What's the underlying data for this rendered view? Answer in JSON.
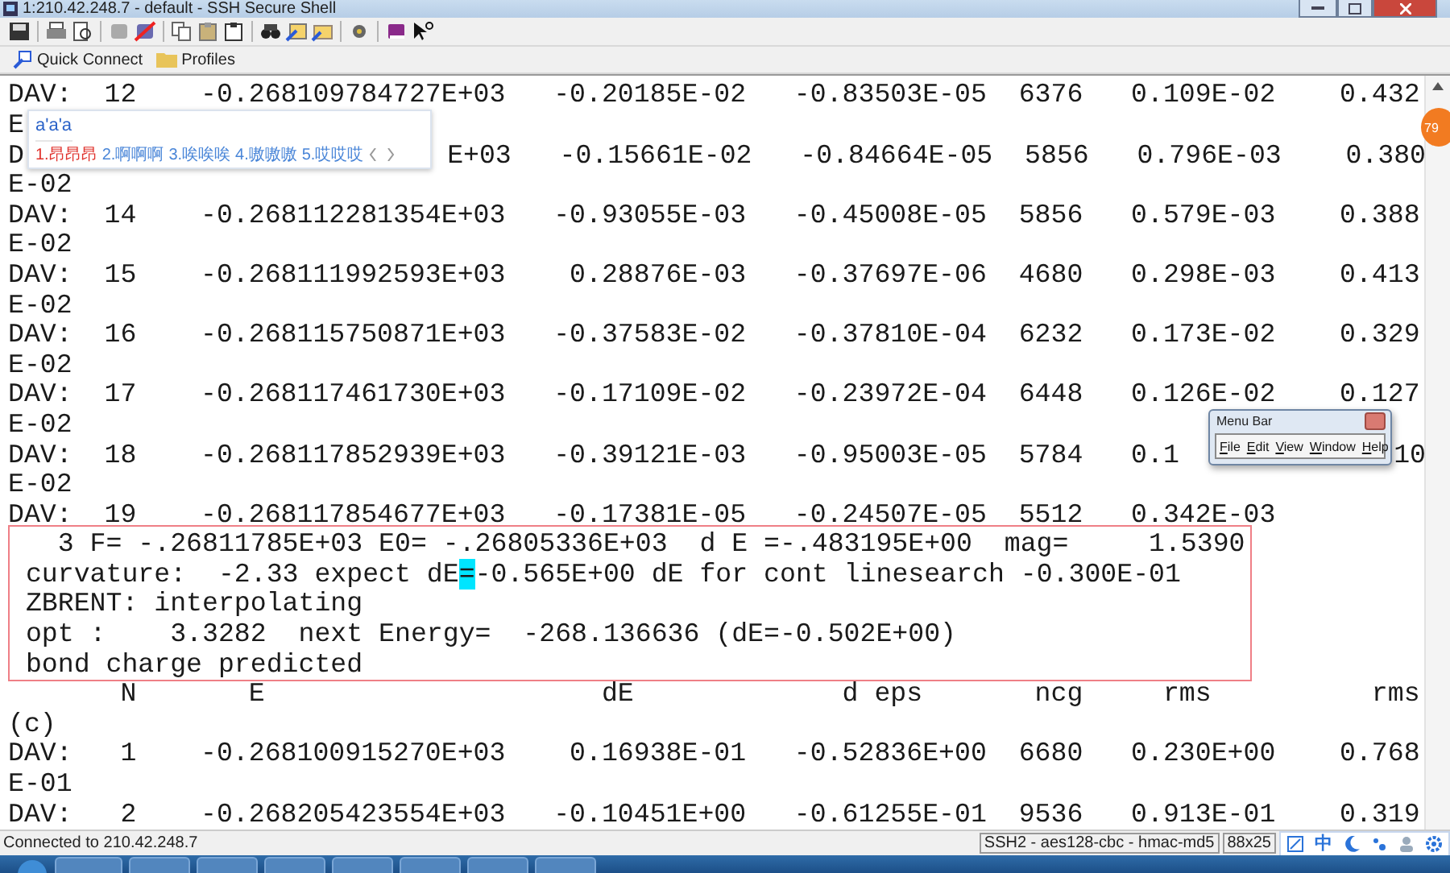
{
  "window": {
    "title": "1:210.42.248.7 - default - SSH Secure Shell"
  },
  "toolbar2": [
    {
      "label": "Quick Connect",
      "kind": "connect"
    },
    {
      "label": "Profiles",
      "kind": "folder"
    }
  ],
  "terminal": {
    "lines": [
      {
        "text": "DAV:  12    -0.268109784727E+03   -0.20185E-02   -0.83503E-05  6376   0.109E-02    0.432",
        "framed": false
      },
      {
        "text": "E",
        "framed": false
      },
      {
        "parts": [
          "D",
          "E+03   -0.15661E-02   -0.84664E-05  5856   0.796E-03    0.380"
        ],
        "framed": false
      },
      {
        "text": "E-02",
        "framed": false
      },
      {
        "text": "DAV:  14    -0.268112281354E+03   -0.93055E-03   -0.45008E-05  5856   0.579E-03    0.388",
        "framed": false
      },
      {
        "text": "E-02",
        "framed": false
      },
      {
        "text": "DAV:  15    -0.268111992593E+03    0.28876E-03   -0.37697E-06  4680   0.298E-03    0.413",
        "framed": false
      },
      {
        "text": "E-02",
        "framed": false
      },
      {
        "text": "DAV:  16    -0.268115750871E+03   -0.37583E-02   -0.37810E-04  6232   0.173E-02    0.329",
        "framed": false
      },
      {
        "text": "E-02",
        "framed": false
      },
      {
        "text": "DAV:  17    -0.268117461730E+03   -0.17109E-02   -0.23972E-04  6448   0.126E-02    0.127",
        "framed": false
      },
      {
        "text": "E-02",
        "framed": false
      },
      {
        "parts": [
          "DAV:  18    -0.268117852939E+03   -0.39121E-03   -0.95003E-05  5784   0.1",
          "10"
        ],
        "framed": false
      },
      {
        "text": "E-02",
        "framed": false
      },
      {
        "text": "DAV:  19    -0.268117854677E+03   -0.17381E-05   -0.24507E-05  5512   0.342E-03",
        "framed": false
      },
      {
        "text": "   3 F= -.26811785E+03 E0= -.26805336E+03  d E =-.483195E+00  mag=     1.5390",
        "framed": true
      },
      {
        "segments": [
          {
            "text": " curvature:  -2.33 expect dE",
            "highlighted": false
          },
          {
            "text": "=",
            "highlighted": true
          },
          {
            "text": "-0.565E+00 dE for cont linesearch -0.300E-01",
            "highlighted": false
          }
        ],
        "framed": true
      },
      {
        "text": " ZBRENT: interpolating",
        "framed": true
      },
      {
        "text": " opt :    3.3282  next Energy=  -268.136636 (dE=-0.502E+00)",
        "framed": true
      },
      {
        "text": " bond charge predicted",
        "framed": true
      },
      {
        "text": "       N       E                     dE             d eps       ncg     rms          rms",
        "framed": false
      },
      {
        "text": "(c)",
        "framed": false
      },
      {
        "text": "DAV:   1    -0.268100915270E+03    0.16938E-01   -0.52836E+00  6680   0.230E+00    0.768",
        "framed": false
      },
      {
        "text": "E-01",
        "framed": false
      },
      {
        "text": "DAV:   2    -0.268205423554E+03   -0.10451E+00   -0.61255E-01  9536   0.913E-01    0.319",
        "framed": false
      }
    ]
  },
  "ime_popup": {
    "input": "a'a'a",
    "candidates": [
      {
        "label": "1.昂昂昂",
        "selected": true
      },
      {
        "label": "2.啊啊啊",
        "selected": false
      },
      {
        "label": "3.唉唉唉",
        "selected": false
      },
      {
        "label": "4.嗷嗷嗷",
        "selected": false
      },
      {
        "label": "5.哎哎哎",
        "selected": false
      }
    ]
  },
  "badge": "79",
  "menu_bar_window": {
    "title": "Menu Bar",
    "items": [
      "File",
      "Edit",
      "View",
      "Window",
      "Help"
    ]
  },
  "status_bar": {
    "connection": "Connected to 210.42.248.7",
    "cipher": "SSH2 - aes128-cbc - hmac-md5",
    "size": "88x25"
  },
  "ime_toolbar": {
    "mode": "中"
  }
}
